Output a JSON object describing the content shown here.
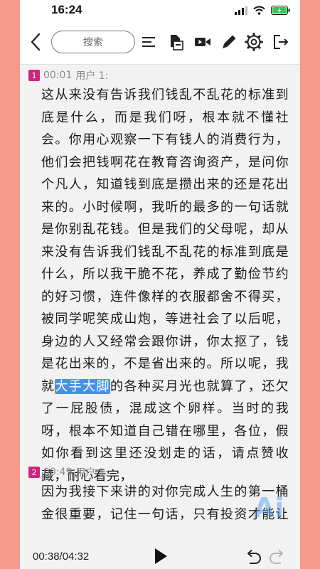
{
  "status": {
    "time": "16:24"
  },
  "toolbar": {
    "search_placeholder": "搜索"
  },
  "segments": [
    {
      "index": "1",
      "timestamp": "00:01",
      "speaker": "用户 1:",
      "text_before": "这从来没有告诉我们钱乱不乱花的标准到底是什么，而是我们呀，根本就不懂社会。你用心观察一下有钱人的消费行为，他们会把钱啊花在教育咨询资产，是问你个凡人，知道钱到底是攒出来的还是花出来的。小时候啊，我听的最多的一句话就是你别乱花钱。但是我们的父母呢，却从来没有告诉我们钱乱不乱花的标准到底是什么，所以我干脆不花，养成了勤俭节约的好习惯，连件像样的衣服都舍不得买，被同学呢笑成山炮，等进社会了以后呢，身边的人又经常会跟你讲，你太抠了，钱是花出来的，不是省出来的。所以呢，我就",
      "text_highlight": "大手大脚",
      "text_after": "的各种买月光也就算了，还欠了一屁股债，混成这个卵样。当时的我呀，根本不知道自己错在哪里，各位，假如你看到这里还没划走的话，请点赞收藏，耐心看完，"
    },
    {
      "index": "2",
      "timestamp": "00:49",
      "speaker": "用户 1:",
      "text": "因为我接下来讲的对你完成人生的第一桶金很重要，记住一句话，只有投资才能让消费才能让我们的钱呢越花越多，能赚会"
    }
  ],
  "watermark": "Ai",
  "player": {
    "elapsed": "00:38/04:32"
  },
  "colors": {
    "frame": "#f59a8c",
    "badge": "#d1227f",
    "highlight": "#4a90e2"
  }
}
